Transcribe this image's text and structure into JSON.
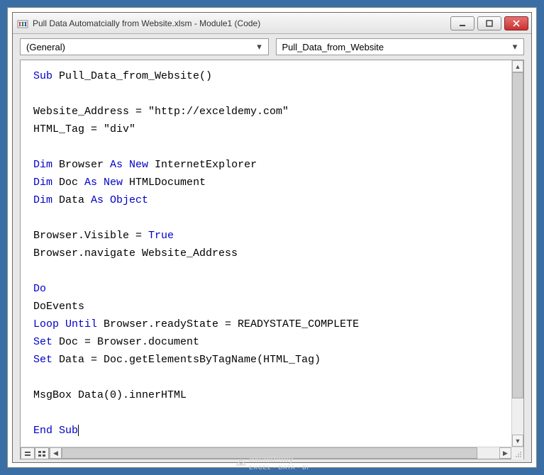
{
  "window": {
    "title": "Pull Data Automatcially from Website.xlsm - Module1 (Code)"
  },
  "dropdowns": {
    "object": "(General)",
    "procedure": "Pull_Data_from_Website"
  },
  "code": {
    "tokens": [
      {
        "t": "kw",
        "v": "Sub"
      },
      {
        "t": "",
        "v": " Pull_Data_from_Website()"
      },
      {
        "t": "nl"
      },
      {
        "t": "nl"
      },
      {
        "t": "",
        "v": "Website_Address = \"http://exceldemy.com\""
      },
      {
        "t": "nl"
      },
      {
        "t": "",
        "v": "HTML_Tag = \"div\""
      },
      {
        "t": "nl"
      },
      {
        "t": "nl"
      },
      {
        "t": "kw",
        "v": "Dim"
      },
      {
        "t": "",
        "v": " Browser "
      },
      {
        "t": "kw",
        "v": "As New"
      },
      {
        "t": "",
        "v": " InternetExplorer"
      },
      {
        "t": "nl"
      },
      {
        "t": "kw",
        "v": "Dim"
      },
      {
        "t": "",
        "v": " Doc "
      },
      {
        "t": "kw",
        "v": "As New"
      },
      {
        "t": "",
        "v": " HTMLDocument"
      },
      {
        "t": "nl"
      },
      {
        "t": "kw",
        "v": "Dim"
      },
      {
        "t": "",
        "v": " Data "
      },
      {
        "t": "kw",
        "v": "As Object"
      },
      {
        "t": "nl"
      },
      {
        "t": "nl"
      },
      {
        "t": "",
        "v": "Browser.Visible = "
      },
      {
        "t": "kw",
        "v": "True"
      },
      {
        "t": "nl"
      },
      {
        "t": "",
        "v": "Browser.navigate Website_Address"
      },
      {
        "t": "nl"
      },
      {
        "t": "nl"
      },
      {
        "t": "kw",
        "v": "Do"
      },
      {
        "t": "nl"
      },
      {
        "t": "",
        "v": "DoEvents"
      },
      {
        "t": "nl"
      },
      {
        "t": "kw",
        "v": "Loop Until"
      },
      {
        "t": "",
        "v": " Browser.readyState = READYSTATE_COMPLETE"
      },
      {
        "t": "nl"
      },
      {
        "t": "kw",
        "v": "Set"
      },
      {
        "t": "",
        "v": " Doc = Browser.document"
      },
      {
        "t": "nl"
      },
      {
        "t": "kw",
        "v": "Set"
      },
      {
        "t": "",
        "v": " Data = Doc.getElementsByTagName(HTML_Tag)"
      },
      {
        "t": "nl"
      },
      {
        "t": "nl"
      },
      {
        "t": "",
        "v": "MsgBox Data(0).innerHTML"
      },
      {
        "t": "nl"
      },
      {
        "t": "nl"
      },
      {
        "t": "kw",
        "v": "End Sub"
      },
      {
        "t": "cursor"
      }
    ]
  },
  "watermark": {
    "main": "exceldemy",
    "sub": "EXCEL · DATA · BI"
  }
}
